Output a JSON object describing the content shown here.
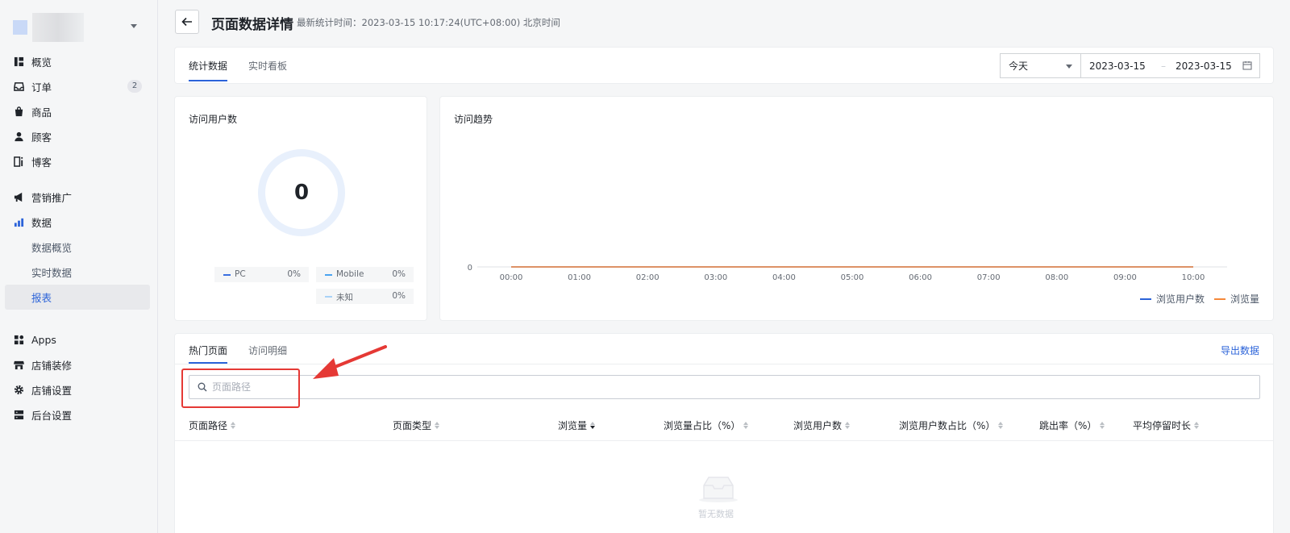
{
  "sidebar": {
    "items": [
      {
        "label": "概览"
      },
      {
        "label": "订单",
        "badge": "2"
      },
      {
        "label": "商品"
      },
      {
        "label": "顾客"
      },
      {
        "label": "博客"
      },
      {
        "label": "营销推广"
      },
      {
        "label": "数据"
      },
      {
        "label": "数据概览"
      },
      {
        "label": "实时数据"
      },
      {
        "label": "报表"
      },
      {
        "label": "Apps"
      },
      {
        "label": "店铺装修"
      },
      {
        "label": "店铺设置"
      },
      {
        "label": "后台设置"
      }
    ]
  },
  "header": {
    "title": "页面数据详情",
    "subtitle": "最新统计时间：2023-03-15 10:17:24(UTC+08:00) 北京时间"
  },
  "top_tabs": [
    {
      "label": "统计数据"
    },
    {
      "label": "实时看板"
    }
  ],
  "date_filter": {
    "range": "今天",
    "start": "2023-03-15",
    "separator": "–",
    "end": "2023-03-15"
  },
  "visitors": {
    "title": "访问用户数",
    "total": "0",
    "legend": [
      {
        "label": "PC",
        "value": "0%",
        "color": "#3a6fe0"
      },
      {
        "label": "Mobile",
        "value": "0%",
        "color": "#4aa3f0"
      },
      {
        "label": "未知",
        "value": "0%",
        "color": "#a8d2f7"
      }
    ]
  },
  "trend": {
    "title": "访问趋势",
    "legend": [
      {
        "label": "浏览用户数",
        "color": "#2b63d9"
      },
      {
        "label": "浏览量",
        "color": "#f5883a"
      }
    ]
  },
  "chart_data": {
    "type": "line",
    "x": [
      "00:00",
      "01:00",
      "02:00",
      "03:00",
      "04:00",
      "05:00",
      "06:00",
      "07:00",
      "08:00",
      "09:00",
      "10:00"
    ],
    "y_ticks": [
      "0"
    ],
    "series": [
      {
        "name": "浏览用户数",
        "values": [
          0,
          0,
          0,
          0,
          0,
          0,
          0,
          0,
          0,
          0,
          0
        ],
        "color": "#2b63d9"
      },
      {
        "name": "浏览量",
        "values": [
          0,
          0,
          0,
          0,
          0,
          0,
          0,
          0,
          0,
          0,
          0
        ],
        "color": "#f5883a"
      }
    ],
    "title": "访问趋势",
    "xlabel": "",
    "ylabel": "",
    "legend_position": "bottom-right",
    "grid": false
  },
  "bottom": {
    "tabs": [
      {
        "label": "热门页面"
      },
      {
        "label": "访问明细"
      }
    ],
    "export_label": "导出数据",
    "search_placeholder": "页面路径",
    "columns": [
      {
        "label": "页面路径"
      },
      {
        "label": "页面类型"
      },
      {
        "label": "浏览量"
      },
      {
        "label": "浏览量占比（%）"
      },
      {
        "label": "浏览用户数"
      },
      {
        "label": "浏览用户数占比（%）"
      },
      {
        "label": "跳出率（%）"
      },
      {
        "label": "平均停留时长"
      }
    ],
    "empty_text": "暂无数据"
  },
  "annotation_color": "#e53935"
}
